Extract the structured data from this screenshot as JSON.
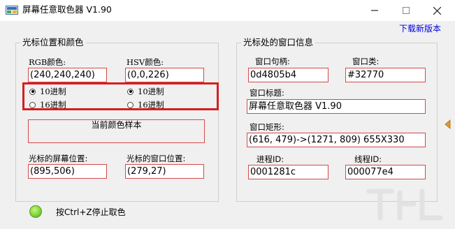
{
  "window": {
    "title": "屏幕任意取色器 V1.90",
    "download_link": "下载新版本",
    "colors": {
      "highlight": "#d41f1f",
      "field_border": "#d24a4a",
      "link": "#0000dd"
    }
  },
  "color_group": {
    "title": "光标位置和颜色",
    "rgb_label": "RGB颜色:",
    "rgb_value": "(240,240,240)",
    "hsv_label": "HSV颜色:",
    "hsv_value": "(0,0,226)",
    "rgb_radios": [
      {
        "label": "10进制",
        "selected": true
      },
      {
        "label": "16进制",
        "selected": false
      }
    ],
    "hsv_radios": [
      {
        "label": "10进制",
        "selected": true
      },
      {
        "label": "16进制",
        "selected": false
      }
    ],
    "sample_label": "当前颜色样本",
    "screen_pos_label": "光标的屏幕位置:",
    "screen_pos_value": "(895,506)",
    "window_pos_label": "光标的窗口位置:",
    "window_pos_value": "(279,27)"
  },
  "window_group": {
    "title": "光标处的窗口信息",
    "handle_label": "窗口句柄:",
    "handle_value": "0d4805b4",
    "class_label": "窗口类:",
    "class_value": "#32770",
    "caption_label": "窗口标题:",
    "caption_value": "屏幕任意取色器 V1.90",
    "rect_label": "窗口矩形:",
    "rect_value": "(616, 479)->(1271, 809) 655X330",
    "pid_label": "进程ID:",
    "pid_value": "0001281c",
    "tid_label": "线程ID:",
    "tid_value": "000077e4"
  },
  "status": {
    "hint": "按Ctrl+Z停止取色",
    "led_color": "#7fd63a"
  },
  "icons": {
    "app": "color-picker-app-icon",
    "minimize": "minimize-icon",
    "maximize": "maximize-icon",
    "close": "close-icon",
    "side": "collapse-arrow-icon"
  }
}
